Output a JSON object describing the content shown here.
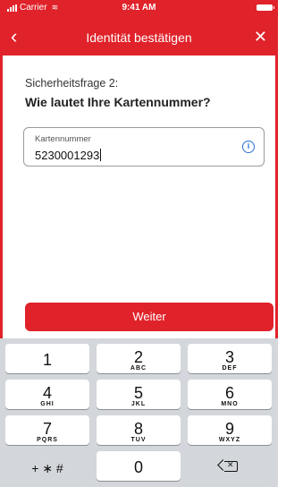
{
  "status": {
    "carrier": "Carrier",
    "time": "9:41 AM"
  },
  "header": {
    "title": "Identität bestätigen"
  },
  "question": {
    "label": "Sicherheitsfrage 2:",
    "text": "Wie lautet Ihre Kartennummer?"
  },
  "field": {
    "label": "Kartennummer",
    "value": "5230001293"
  },
  "button": {
    "label": "Weiter"
  },
  "keypad": {
    "keys": [
      {
        "num": "1",
        "sub": ""
      },
      {
        "num": "2",
        "sub": "ABC"
      },
      {
        "num": "3",
        "sub": "DEF"
      },
      {
        "num": "4",
        "sub": "GHI"
      },
      {
        "num": "5",
        "sub": "JKL"
      },
      {
        "num": "6",
        "sub": "MNO"
      },
      {
        "num": "7",
        "sub": "PQRS"
      },
      {
        "num": "8",
        "sub": "TUV"
      },
      {
        "num": "9",
        "sub": "WXYZ"
      },
      {
        "num": "+ ∗ #",
        "sub": ""
      },
      {
        "num": "0",
        "sub": ""
      }
    ]
  },
  "colors": {
    "accent": "#e0222a",
    "info": "#2a70d6",
    "keypad_bg": "#d3d6db"
  }
}
